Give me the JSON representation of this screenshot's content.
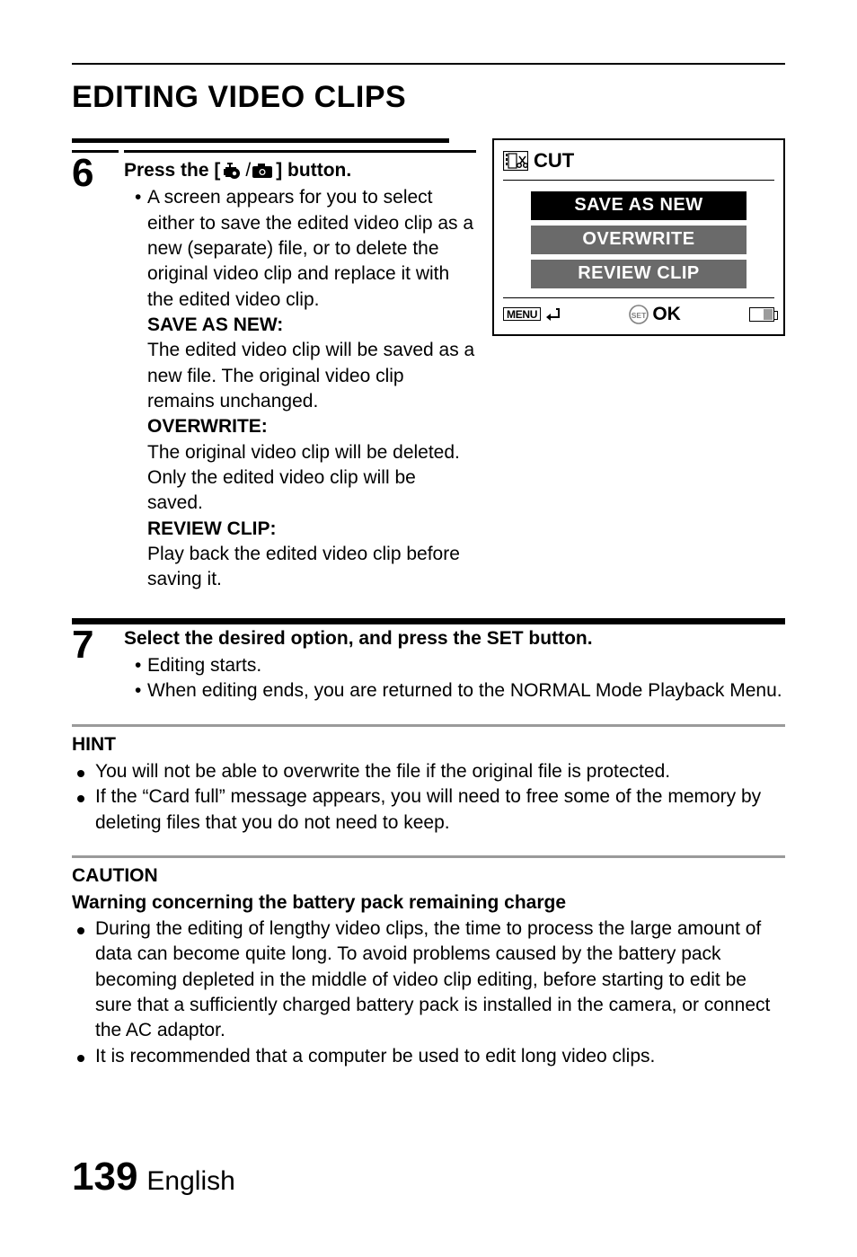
{
  "title": "EDITING VIDEO CLIPS",
  "step6": {
    "number": "6",
    "head_prefix": "Press the [",
    "head_suffix": "] button.",
    "icon_video_name": "video-camera-icon",
    "icon_photo_name": "photo-camera-icon",
    "bullet1": "A screen appears for you to select either to save the edited video clip as a new (separate) file, or to delete the original video clip and replace it with the edited video clip.",
    "save_as_new_label": "SAVE AS NEW:",
    "save_as_new_text": "The edited video clip will be saved as a new file. The original video clip remains unchanged.",
    "overwrite_label": "OVERWRITE:",
    "overwrite_text": "The original video clip will be deleted. Only the edited video clip will be saved.",
    "review_label": "REVIEW CLIP:",
    "review_text": "Play back the edited video clip before saving it."
  },
  "screen": {
    "title": "CUT",
    "item1": "SAVE AS NEW",
    "item2": "OVERWRITE",
    "item3": "REVIEW CLIP",
    "menu_label": "MENU",
    "ok_label": "OK"
  },
  "step7": {
    "number": "7",
    "head": "Select the desired option, and press the SET button.",
    "bullet1": "Editing starts.",
    "bullet2": "When editing ends, you are returned to the NORMAL Mode Playback Menu."
  },
  "hint": {
    "label": "HINT",
    "bullet1": "You will not be able to overwrite the file if the original file is protected.",
    "bullet2": "If the “Card full” message appears, you will need to free some of the memory by deleting files that you do not need to keep."
  },
  "caution": {
    "label": "CAUTION",
    "sub": "Warning concerning the battery pack remaining charge",
    "bullet1": "During the editing of lengthy video clips, the time to process the large amount of data can become quite long. To avoid problems caused by the battery pack becoming depleted in the middle of video clip editing, before starting to edit be sure that a sufficiently charged battery pack is installed in the camera, or connect the AC adaptor.",
    "bullet2": "It is recommended that a computer be used to edit long video clips."
  },
  "footer": {
    "page": "139",
    "lang": "English"
  }
}
